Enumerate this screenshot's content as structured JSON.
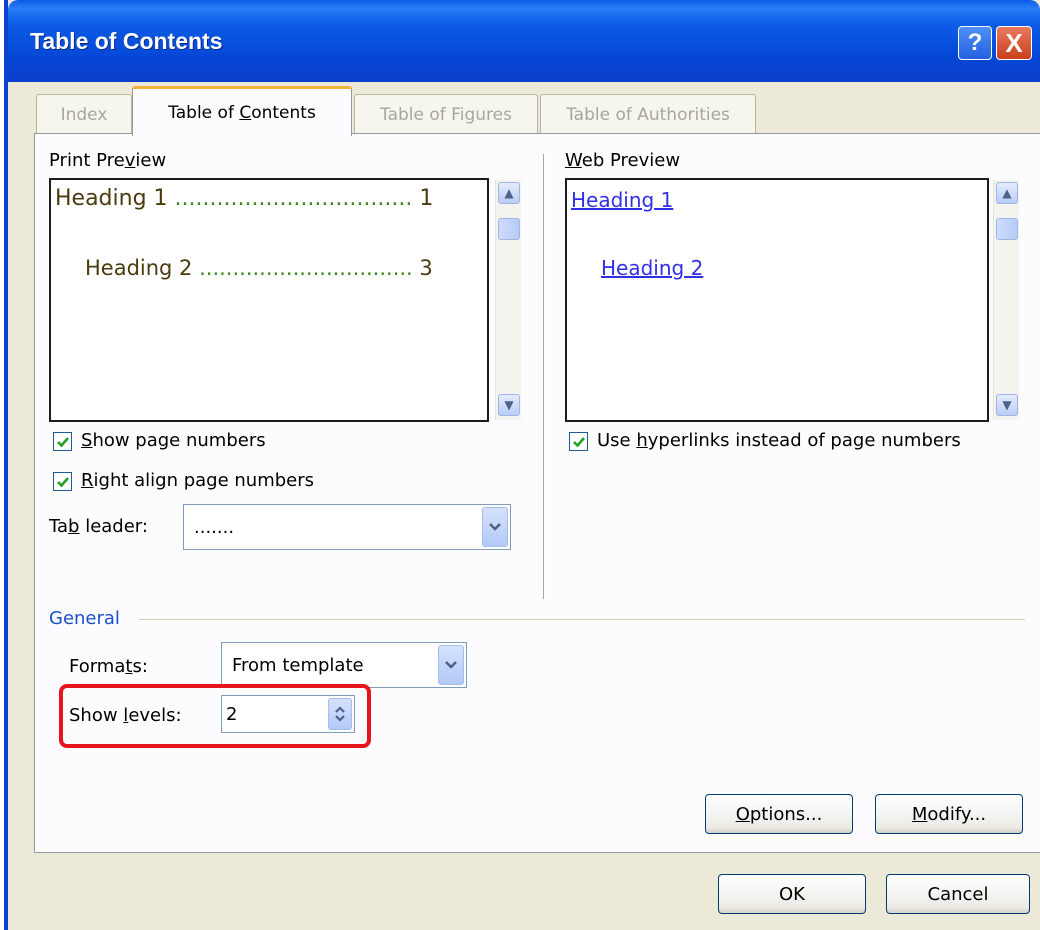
{
  "window": {
    "title": "Table of Contents",
    "help_glyph": "?",
    "close_glyph": "X"
  },
  "tabs": [
    {
      "label": "Index",
      "active": false
    },
    {
      "label_pre": "Table of ",
      "label_key": "C",
      "label_post": "ontents",
      "active": true
    },
    {
      "label": "Table of Figures",
      "active": false
    },
    {
      "label": "Table of Authorities",
      "active": false
    }
  ],
  "print_preview": {
    "label_pre": "Print Pre",
    "label_key": "v",
    "label_post": "iew",
    "lines": [
      {
        "text": "Heading 1",
        "dots": "..................................",
        "page": "1"
      },
      {
        "text": "Heading 2",
        "dots": "................................",
        "page": "3"
      }
    ]
  },
  "web_preview": {
    "label_key": "W",
    "label_post": "eb Preview",
    "links": [
      "Heading 1",
      "Heading 2"
    ]
  },
  "options": {
    "show_page_numbers": {
      "key": "S",
      "rest": "how page numbers",
      "checked": true
    },
    "right_align": {
      "key": "R",
      "rest": "ight align page numbers",
      "checked": true
    },
    "use_hyperlinks": {
      "pre": "Use ",
      "key": "h",
      "rest": "yperlinks instead of page numbers",
      "checked": true
    },
    "tab_leader": {
      "label_pre": "Ta",
      "label_key": "b",
      "label_post": " leader:",
      "value": "......."
    }
  },
  "general": {
    "section_label": "General",
    "formats": {
      "label_pre": "Forma",
      "label_key": "t",
      "label_post": "s:",
      "value": "From template"
    },
    "show_levels": {
      "label_pre": "Show ",
      "label_key": "l",
      "label_post": "evels:",
      "value": "2"
    }
  },
  "buttons": {
    "options": {
      "key": "O",
      "rest": "ptions..."
    },
    "modify": {
      "key": "M",
      "rest": "odify..."
    },
    "ok": "OK",
    "cancel": "Cancel"
  },
  "colors": {
    "title_bar": "#0a4fe0",
    "dialog_bg": "#ece9d8",
    "highlight_box": "#e8141c",
    "link": "#3030e8",
    "section_label": "#1c50c8"
  }
}
